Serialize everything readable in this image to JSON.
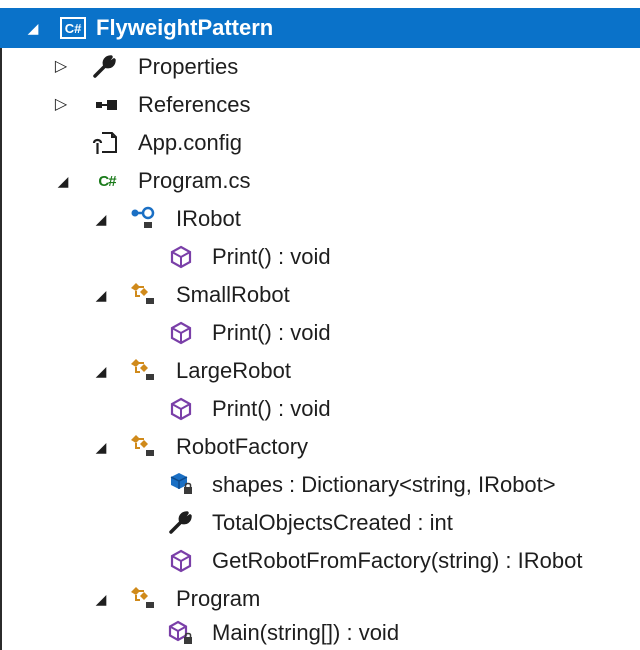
{
  "tree": {
    "project": {
      "label": "FlyweightPattern",
      "icon": "csharp-project-icon",
      "badge_text": "C#",
      "selection_color": "#0a72c9"
    },
    "properties": {
      "label": "Properties",
      "icon": "wrench-icon"
    },
    "references": {
      "label": "References",
      "icon": "references-icon"
    },
    "app_config": {
      "label": "App.config",
      "icon": "config-file-icon"
    },
    "program_cs": {
      "label": "Program.cs",
      "icon": "csharp-file-icon",
      "badge_text": "C#"
    },
    "irobot": {
      "label": "IRobot",
      "icon": "interface-icon"
    },
    "irobot_print": {
      "label": "Print() : void",
      "icon": "method-icon"
    },
    "small_robot": {
      "label": "SmallRobot",
      "icon": "class-icon"
    },
    "small_robot_print": {
      "label": "Print() : void",
      "icon": "method-icon"
    },
    "large_robot": {
      "label": "LargeRobot",
      "icon": "class-icon"
    },
    "large_robot_print": {
      "label": "Print() : void",
      "icon": "method-icon"
    },
    "robot_factory": {
      "label": "RobotFactory",
      "icon": "class-icon"
    },
    "shapes_field": {
      "label": "shapes : Dictionary<string, IRobot>",
      "icon": "private-field-icon"
    },
    "total_objects": {
      "label": "TotalObjectsCreated : int",
      "icon": "property-icon"
    },
    "get_robot": {
      "label": "GetRobotFromFactory(string) : IRobot",
      "icon": "method-icon"
    },
    "program_class": {
      "label": "Program",
      "icon": "class-icon"
    },
    "main_method": {
      "label": "Main(string[]) : void",
      "icon": "private-method-icon"
    }
  }
}
